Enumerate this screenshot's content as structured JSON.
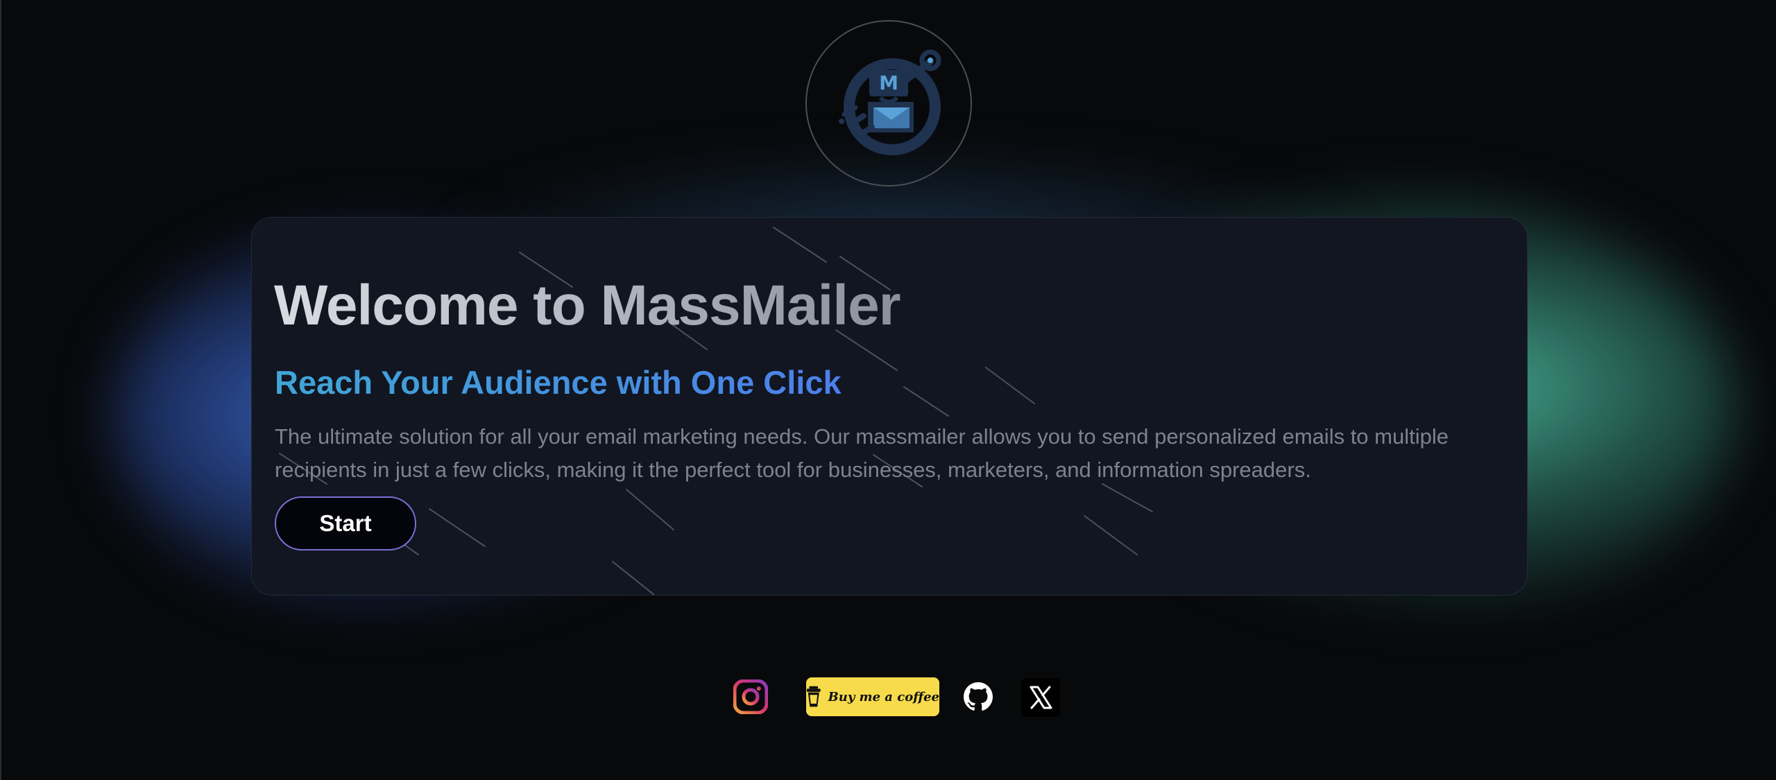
{
  "hero": {
    "title": "Welcome to MassMailer",
    "subtitle": "Reach Your Audience with One Click",
    "description": "The ultimate solution for all your email marketing needs. Our massmailer allows you to send personalized emails to multiple recipients in just a few clicks, making it the perfect tool for businesses, marketers, and information spreaders.",
    "start_label": "Start"
  },
  "logo": {
    "icon": "massmailer-envelope-icon",
    "letter": "M"
  },
  "footer": {
    "links": [
      {
        "icon": "instagram-icon"
      },
      {
        "icon": "coffee-cup-icon",
        "label": "Buy me a coffee"
      },
      {
        "icon": "github-icon"
      },
      {
        "icon": "x-twitter-icon"
      }
    ]
  },
  "colors": {
    "background": "#08090b",
    "card": "#111621",
    "accent_blue": "#4590e0",
    "accent_teal": "#48af96",
    "button_border": "#7c6fd8",
    "coffee_yellow": "#f7db4a"
  }
}
